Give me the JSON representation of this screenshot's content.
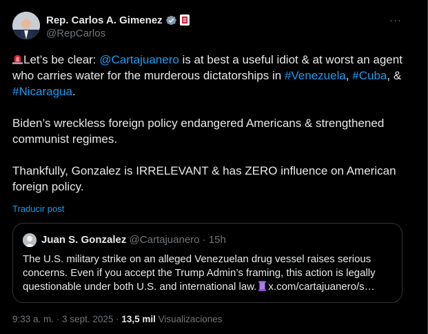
{
  "author": {
    "display_name": "Rep. Carlos A. Gimenez",
    "handle": "@RepCarlos"
  },
  "menu": {
    "more_label": "···"
  },
  "post": {
    "p1_prefix": "Let’s be clear: ",
    "p1_mention": "@Cartajuanero",
    "p1_middle": " is at best a useful idiot & at worst an agent who carries water for the murderous dictatorships in ",
    "p1_hashtag1": "#Venezuela",
    "p1_sep1": ", ",
    "p1_hashtag2": "#Cuba",
    "p1_sep2": ", & ",
    "p1_hashtag3": "#Nicaragua",
    "p1_end": ".",
    "p2": "Biden’s wreckless foreign policy endangered Americans & strengthened communist regimes.",
    "p3": "Thankfully, Gonzalez is IRRELEVANT & has ZERO influence on American foreign policy.",
    "translate_label": "Traducir post"
  },
  "quote": {
    "name": "Juan S. Gonzalez",
    "handle": "@Cartajuanero",
    "separator": " · ",
    "time": "15h",
    "text_before": "The U.S. military strike on an alleged Venezuelan drug vessel raises serious concerns. Even if you accept the Trump Admin’s framing, this action is legally questionable under both U.S. and international law.",
    "link": "x.com/cartajuanero/s…"
  },
  "meta": {
    "time": "9:33 a. m.",
    "dot": " · ",
    "date": "3 sept. 2025",
    "views_count": "13,5 mil",
    "views_label": "Visualizaciones"
  },
  "colors": {
    "background": "#000000",
    "text": "#e7e9ea",
    "muted": "#71767b",
    "link": "#1d9bf0",
    "border": "#2f3336"
  },
  "icons": {
    "verified": "verified-badge-icon",
    "affiliation": "congress-affiliation-icon",
    "siren": "rotating-light-emoji-icon",
    "scroll": "scroll-emoji-icon"
  }
}
